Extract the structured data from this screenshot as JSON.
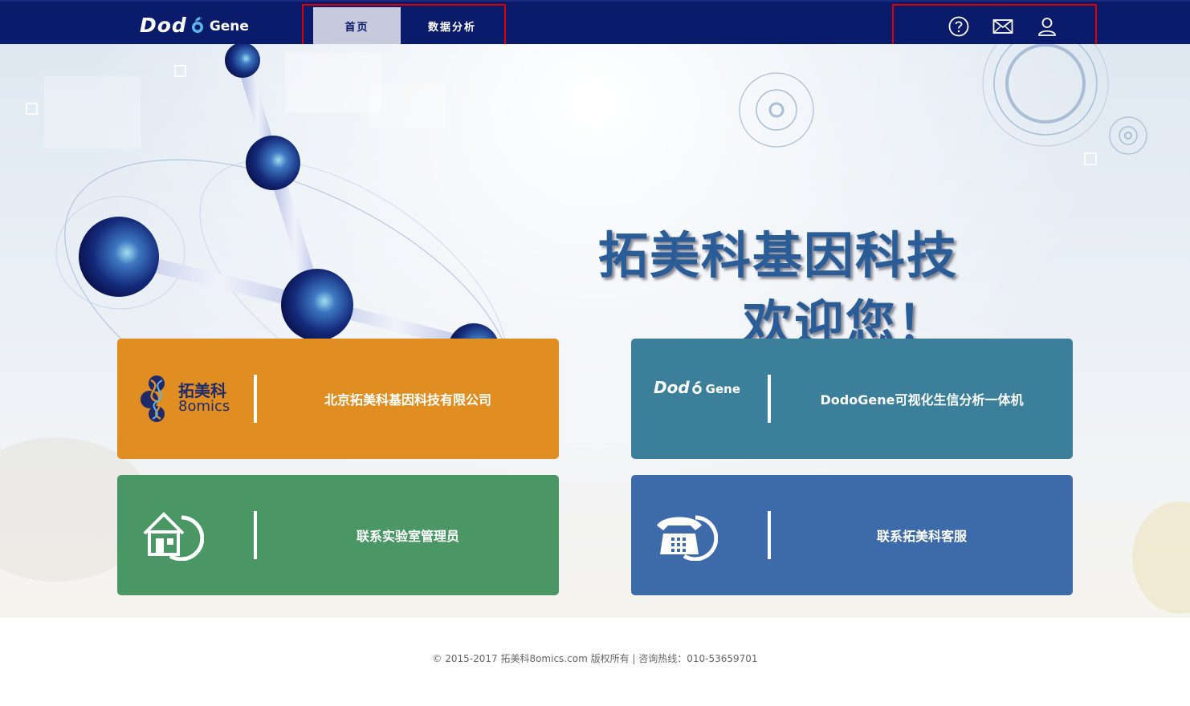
{
  "header": {
    "logo": {
      "left": "Dod",
      "right": "Gene"
    },
    "nav": [
      {
        "label": "首页",
        "active": true
      },
      {
        "label": "数据分析",
        "active": false
      }
    ],
    "tools": [
      {
        "icon": "help-icon",
        "label": "help"
      },
      {
        "icon": "mail-icon",
        "label": "mail"
      },
      {
        "icon": "user-icon",
        "label": "user"
      }
    ]
  },
  "hero": {
    "line1": "拓美科基因科技",
    "line2": "欢迎您！"
  },
  "cards": [
    {
      "logo": {
        "cn": "拓美科",
        "en": "8omics"
      },
      "label": "北京拓美科基因科技有限公司",
      "color": "#e08e22"
    },
    {
      "logo": {
        "left": "Dod",
        "right": "Gene"
      },
      "label": "DodoGene可视化生信分析一体机",
      "color": "#3c7f9b"
    },
    {
      "icon": "home-icon",
      "label": "联系实验室管理员",
      "color": "#4a9665"
    },
    {
      "icon": "telephone-icon",
      "label": "联系拓美科客服",
      "color": "#3d6aa8"
    }
  ],
  "footer": {
    "text": "© 2015-2017 拓美科8omics.com 版权所有 | 咨询热线：010-53659701"
  },
  "colors": {
    "header_bg": "#0b1b6b",
    "nav_active_bg": "#c7c9dc",
    "highlight_border": "#e00000",
    "title_blue": "#2a5d98"
  }
}
